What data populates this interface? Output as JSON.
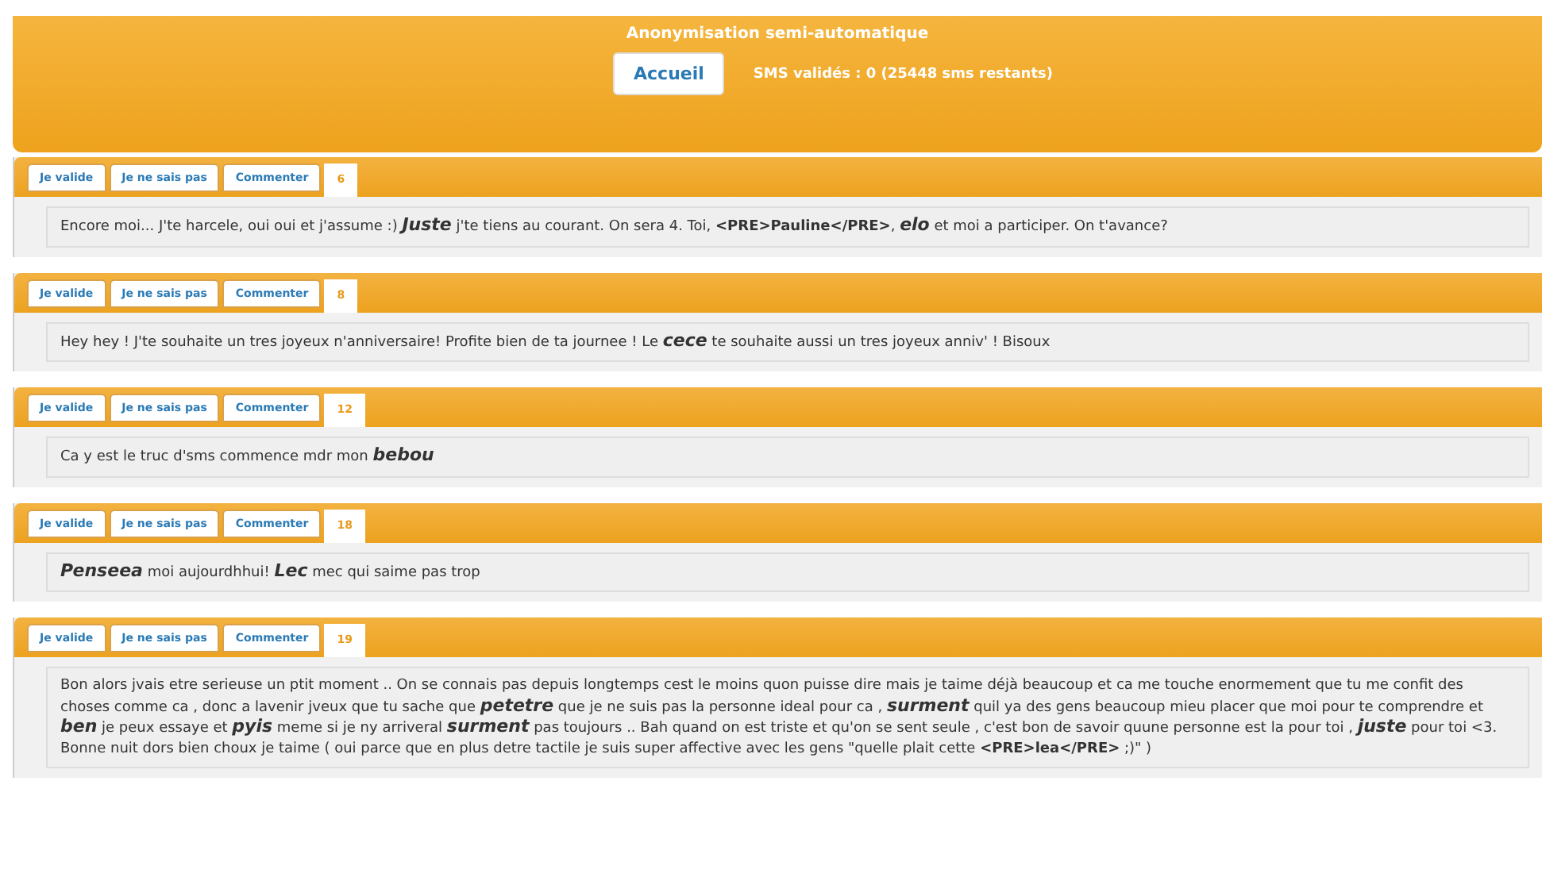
{
  "header": {
    "title": "Anonymisation semi-automatique",
    "home_button": "Accueil",
    "status": "SMS validés : 0 (25448 sms restants)"
  },
  "messages": [
    {
      "actions": [
        "Je valide",
        "Je ne sais pas",
        "Commenter"
      ],
      "number": "6",
      "text": "Encore moi... J'te harcele, oui oui et j'assume :) *Juste* j'te tiens au courant. On sera 4. Toi, **<PRE>Pauline</PRE>**, *elo* et moi a participer. On t'avance?"
    },
    {
      "actions": [
        "Je valide",
        "Je ne sais pas",
        "Commenter"
      ],
      "number": "8",
      "text": "Hey hey ! J'te souhaite un tres joyeux n'anniversaire! Profite bien de ta journee ! Le *cece* te souhaite aussi un tres joyeux anniv' ! Bisoux"
    },
    {
      "actions": [
        "Je valide",
        "Je ne sais pas",
        "Commenter"
      ],
      "number": "12",
      "text": "Ca y est le truc d'sms commence mdr mon *bebou*"
    },
    {
      "actions": [
        "Je valide",
        "Je ne sais pas",
        "Commenter"
      ],
      "number": "18",
      "text": "*Penseea* moi aujourdhhui! *Lec* mec qui saime pas trop"
    },
    {
      "actions": [
        "Je valide",
        "Je ne sais pas",
        "Commenter"
      ],
      "number": "19",
      "text": "Bon alors jvais etre serieuse un ptit moment .. On se connais pas depuis longtemps cest le moins quon puisse dire mais je taime déjà beaucoup et ca me touche enormement que tu me confit des choses comme ca , donc a lavenir jveux que tu sache que *petetre* que je ne suis pas la personne ideal pour ca , *surment* quil ya des gens beaucoup mieu placer que moi pour te comprendre et *ben* je peux essaye et *pyis* meme si je ny arriveral *surment* pas toujours .. Bah quand on est triste et qu'on se sent seule , c'est bon de savoir quune personne est la pour toi , *juste* pour toi <3. Bonne nuit dors bien choux je taime ( oui parce que en plus detre tactile je suis super affective avec les gens \"quelle plait cette **<PRE>lea</PRE>** ;)\" )"
    }
  ]
}
